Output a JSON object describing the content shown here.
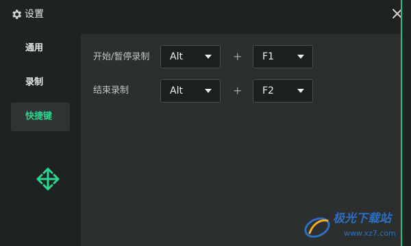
{
  "window": {
    "title": "设置",
    "accent_color": "#1ec27a"
  },
  "icons": {
    "settings": "gear-icon",
    "close": "close-icon",
    "move": "move-arrows-icon",
    "dropdown": "caret-down-icon"
  },
  "sidebar": {
    "items": [
      {
        "label": "通用",
        "active": false
      },
      {
        "label": "录制",
        "active": false
      },
      {
        "label": "快捷键",
        "active": true
      }
    ],
    "active_color": "#2ed48c"
  },
  "shortcuts": {
    "rows": [
      {
        "label": "开始/暂停录制",
        "modifier": "Alt",
        "plus": "+",
        "key": "F1"
      },
      {
        "label": "结束录制",
        "modifier": "Alt",
        "plus": "+",
        "key": "F2"
      }
    ]
  },
  "watermark": {
    "name": "极光下载站",
    "url": "www.xz7.com"
  }
}
